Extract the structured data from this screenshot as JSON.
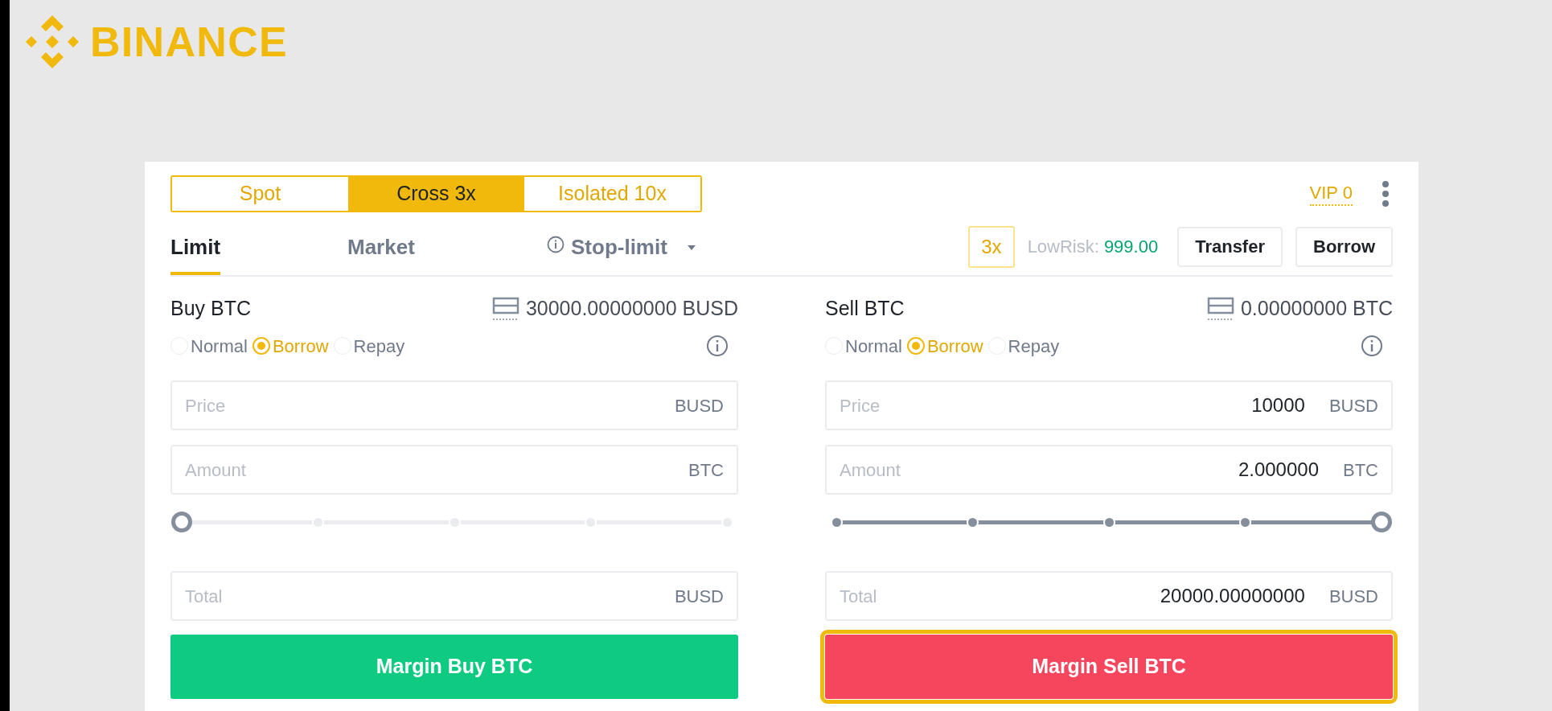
{
  "logo": {
    "text": "BINANCE"
  },
  "margin_tabs": [
    {
      "label": "Spot",
      "selected": false
    },
    {
      "label": "Cross 3x",
      "selected": true
    },
    {
      "label": "Isolated 10x",
      "selected": false
    }
  ],
  "vip": "VIP 0",
  "order_tabs": [
    {
      "label": "Limit",
      "selected": true,
      "kind": "plain"
    },
    {
      "label": "Market",
      "selected": false,
      "kind": "plain"
    },
    {
      "label": "Stop-limit",
      "selected": false,
      "kind": "dropdown"
    }
  ],
  "leverage": "3x",
  "risk": {
    "label": "LowRisk:",
    "value": "999.00"
  },
  "buttons": [
    "Transfer",
    "Borrow"
  ],
  "panels": [
    {
      "title": "Buy BTC",
      "balance": "30000.00000000 BUSD",
      "modes": [
        {
          "label": "Normal",
          "selected": false
        },
        {
          "label": "Borrow",
          "selected": true
        },
        {
          "label": "Repay",
          "selected": false
        }
      ],
      "fields": [
        {
          "placeholder": "Price",
          "unit": "BUSD"
        },
        {
          "placeholder": "Amount",
          "unit": "BTC"
        }
      ],
      "slider": {
        "level": 0
      },
      "total": {
        "placeholder": "Total",
        "unit": "BUSD"
      },
      "action": {
        "label": "Margin Buy BTC",
        "kind": "buy",
        "focused": false
      }
    },
    {
      "title": "Sell BTC",
      "balance": "0.00000000 BTC",
      "modes": [
        {
          "label": "Normal",
          "selected": false
        },
        {
          "label": "Borrow",
          "selected": true
        },
        {
          "label": "Repay",
          "selected": false
        }
      ],
      "fields": [
        {
          "placeholder": "Price",
          "value": "10000",
          "unit": "BUSD"
        },
        {
          "placeholder": "Amount",
          "value": "2.000000",
          "unit": "BTC"
        }
      ],
      "slider": {
        "level": 1
      },
      "total": {
        "placeholder": "Total",
        "value": "20000.00000000",
        "unit": "BUSD"
      },
      "action": {
        "label": "Margin Sell BTC",
        "kind": "sell",
        "focused": true
      }
    }
  ]
}
